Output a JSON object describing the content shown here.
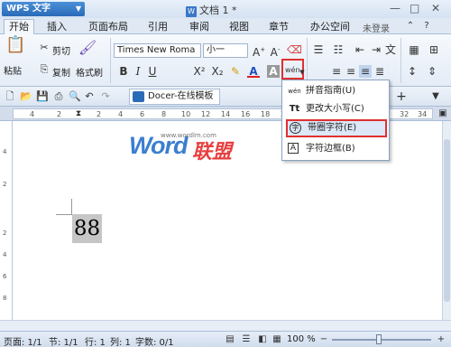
{
  "app": {
    "name": "WPS 文字",
    "doc_title": "文档 1 *"
  },
  "menu": {
    "tabs": [
      "开始",
      "插入",
      "页面布局",
      "引用",
      "审阅",
      "视图",
      "章节",
      "办公空间"
    ],
    "user": "未登录"
  },
  "ribbon": {
    "paste": "粘贴",
    "cut": "剪切",
    "copy": "复制",
    "format_painter": "格式刷",
    "font_name": "Times New Roma",
    "font_size": "小一",
    "bold": "B",
    "italic": "I",
    "underline": "U",
    "superscript": "X²",
    "subscript": "X₂"
  },
  "quickbar": {
    "doc_tab": "Docer-在线模板"
  },
  "ruler": {
    "marks": [
      "4",
      "2",
      "2",
      "4",
      "6",
      "8",
      "10",
      "12",
      "14",
      "16",
      "18",
      "20",
      "22",
      "24",
      "26",
      "28",
      "30",
      "32",
      "34",
      "36"
    ]
  },
  "vruler": {
    "marks": [
      "4",
      "2",
      "2",
      "4",
      "6",
      "8"
    ]
  },
  "document": {
    "content": "88",
    "watermark_word": "Word",
    "watermark_cn": "联盟",
    "watermark_url": "www.wordlm.com"
  },
  "dropdown": {
    "items": [
      {
        "icon": "wén",
        "label": "拼音指南(U)"
      },
      {
        "icon": "Tt",
        "label": "更改大小写(C)"
      },
      {
        "icon": "字",
        "label": "带圈字符(E)"
      },
      {
        "icon": "A",
        "label": "字符边框(B)"
      }
    ]
  },
  "status": {
    "page": "页面: 1/1",
    "section": "节: 1/1",
    "row": "行: 1",
    "col": "列: 1",
    "words": "字数: 0/1",
    "zoom": "100 %"
  }
}
